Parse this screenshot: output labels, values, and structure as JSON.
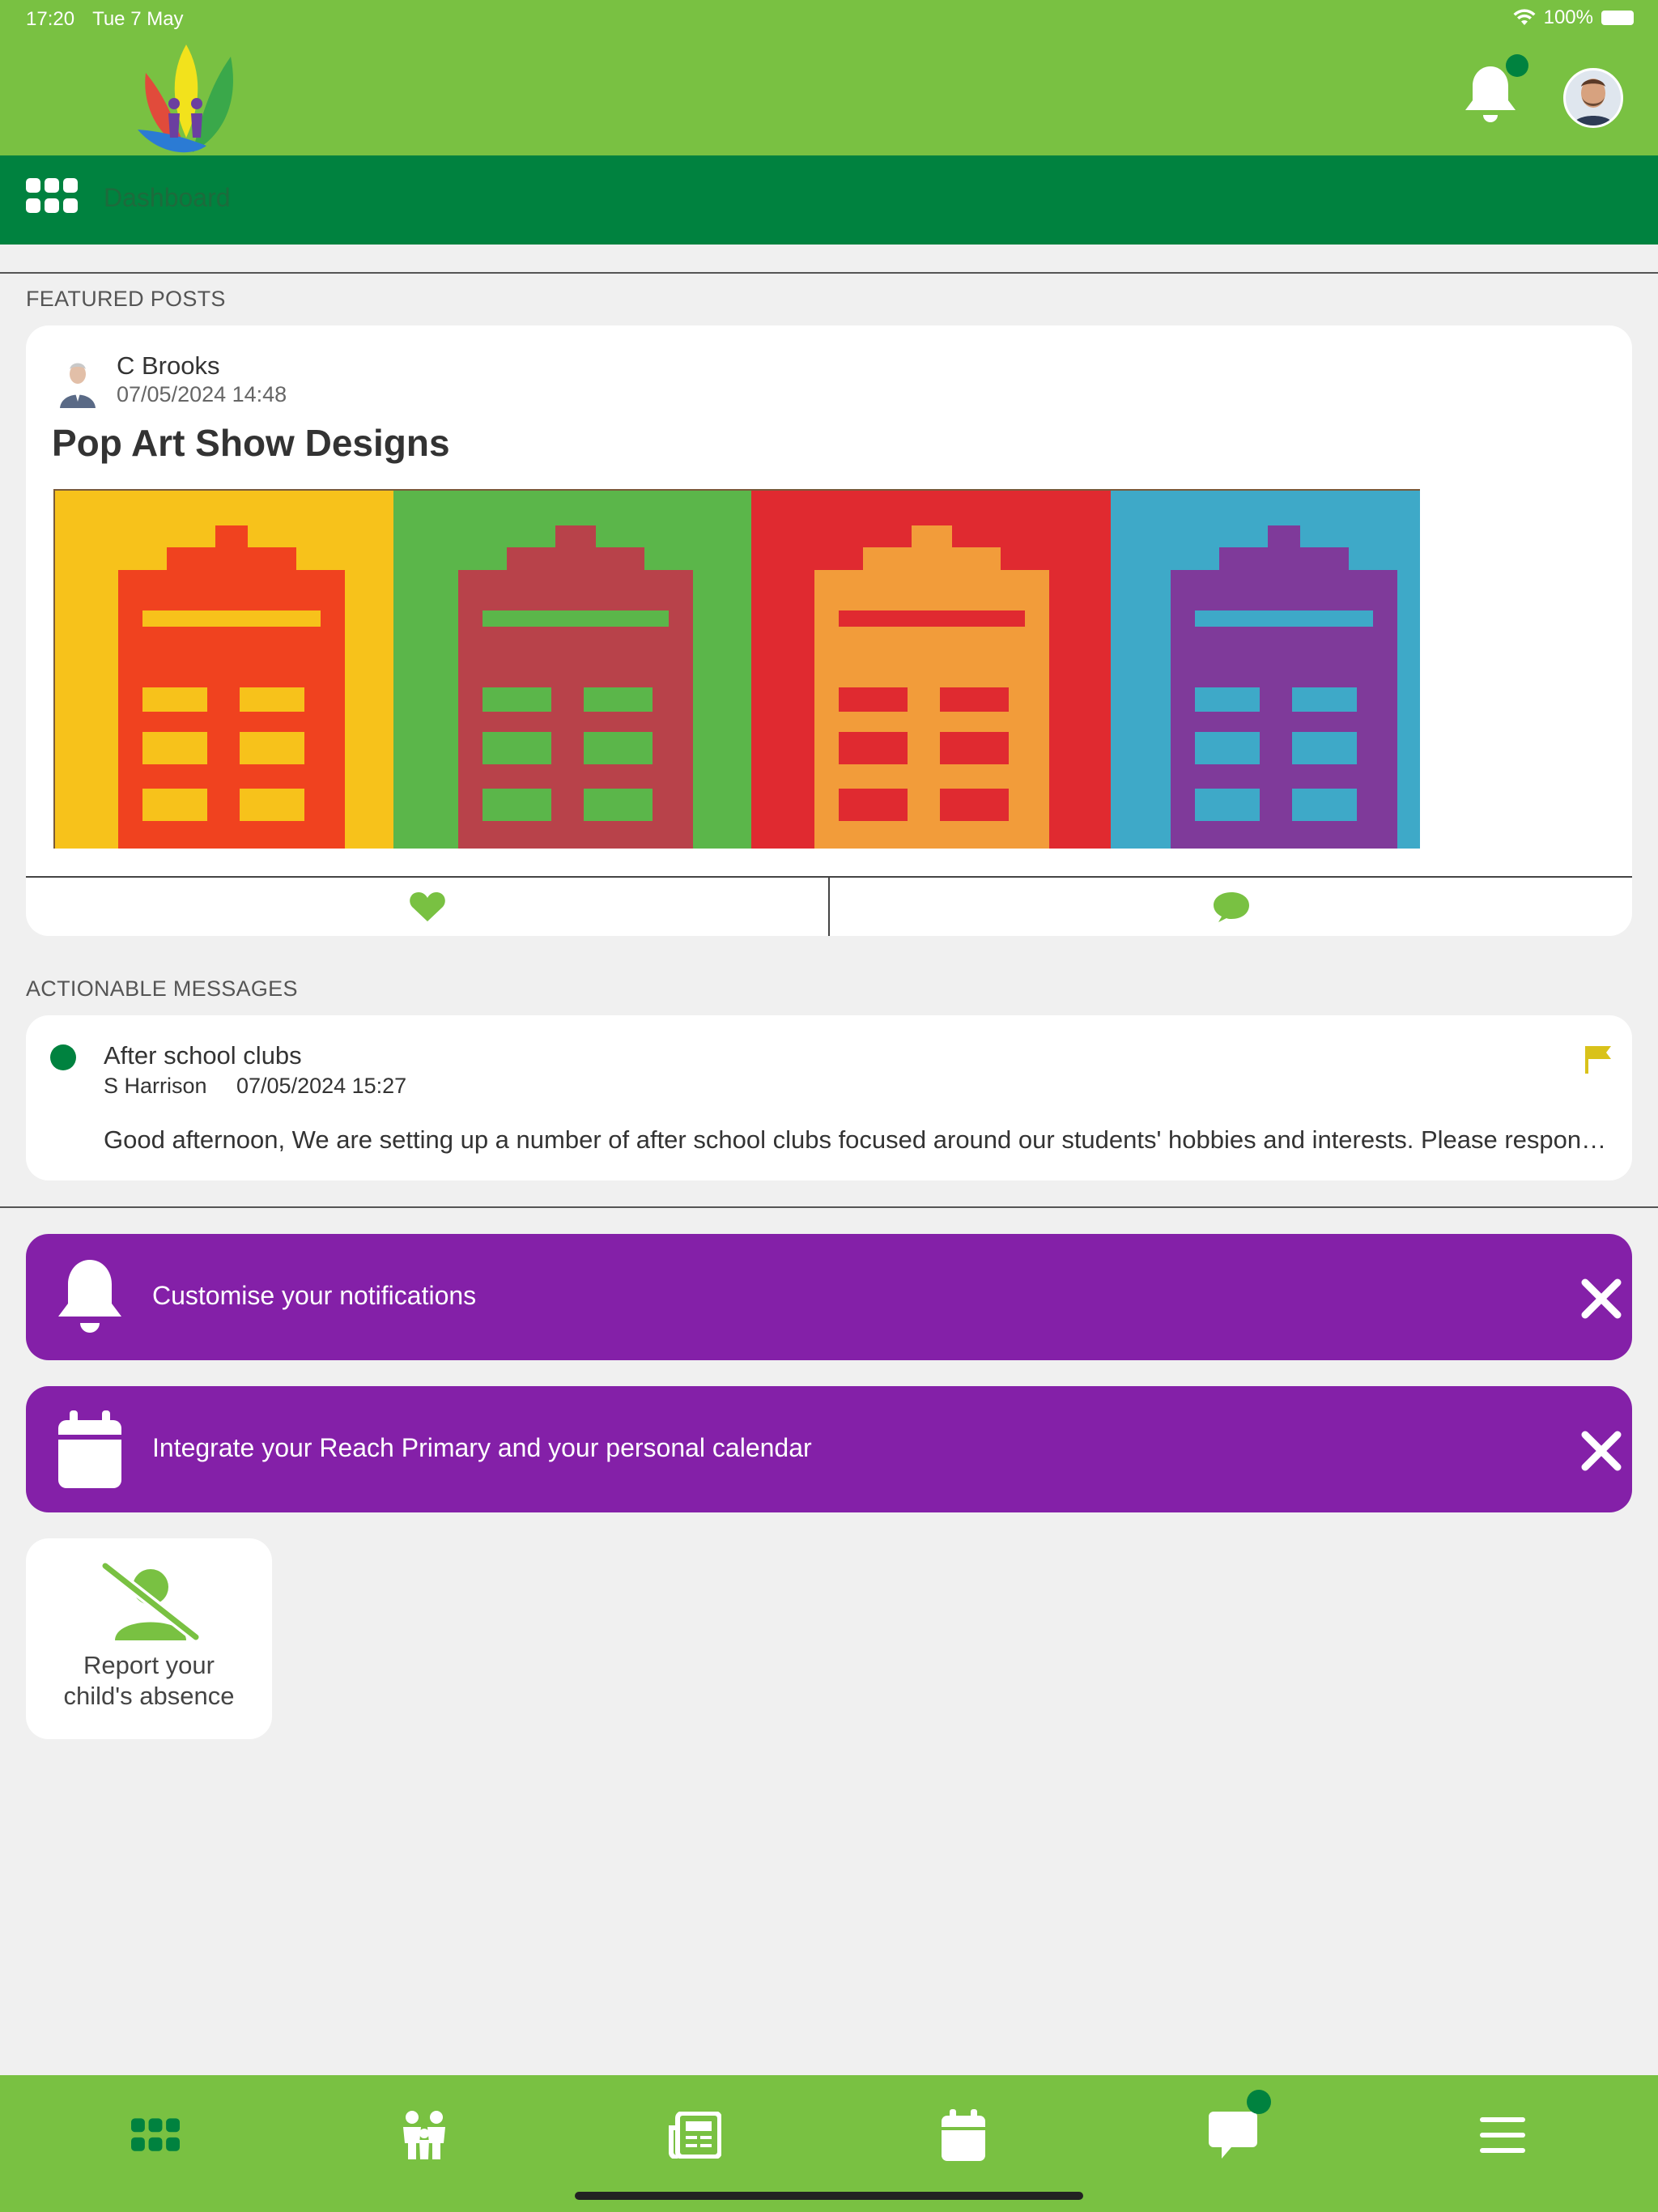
{
  "status": {
    "time": "17:20",
    "date": "Tue 7 May",
    "battery": "100%"
  },
  "colors": {
    "brand_green": "#79c142",
    "dark_green": "#00823f",
    "banner_purple": "#8420a8",
    "flag_yellow": "#d9c21a"
  },
  "header": {
    "nav_title": "Dashboard",
    "notification_badge": true
  },
  "featured": {
    "section_label": "FEATURED POSTS",
    "post": {
      "author": "C Brooks",
      "date": "07/05/2024 14:48",
      "title": "Pop Art Show Designs"
    }
  },
  "actionable": {
    "section_label": "ACTIONABLE MESSAGES",
    "message": {
      "title": "After school clubs",
      "from": "S Harrison",
      "date": "07/05/2024 15:27",
      "body": "Good afternoon, We are setting up a number of after school clubs focused around our students' hobbies and interests. Please respond to let us know which clubs your child would like to attend."
    }
  },
  "banners": [
    {
      "text": "Customise your notifications",
      "icon": "bell-icon"
    },
    {
      "text": "Integrate your Reach Primary and your personal calendar",
      "icon": "calendar-icon"
    }
  ],
  "tiles": [
    {
      "line1": "Report your",
      "line2": "child's absence",
      "icon": "person-off-icon"
    }
  ],
  "tabs": [
    "dashboard-icon",
    "family-icon",
    "news-icon",
    "calendar-icon",
    "messages-icon",
    "menu-icon"
  ]
}
